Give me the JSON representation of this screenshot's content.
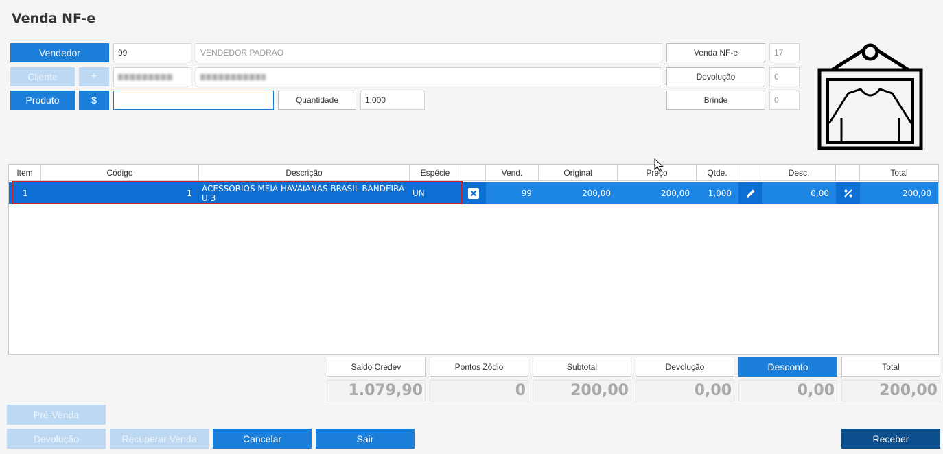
{
  "title": "Venda NF-e",
  "form": {
    "vendedor_label": "Vendedor",
    "vendedor_code": "99",
    "vendedor_name": "VENDEDOR PADRAO",
    "cliente_label": "Cliente",
    "cliente_add": "+",
    "produto_label": "Produto",
    "produto_price": "$",
    "produto_value": "",
    "quantidade_label": "Quantidade",
    "quantidade_value": "1,000"
  },
  "side": {
    "venda_nfe_label": "Venda NF-e",
    "venda_nfe_value": "17",
    "devolucao_label": "Devolução",
    "devolucao_value": "0",
    "brinde_label": "Brinde",
    "brinde_value": "0"
  },
  "grid": {
    "headers": [
      "Item",
      "Código",
      "Descrição",
      "Espécie",
      "",
      "Vend.",
      "Original",
      "Preço",
      "Qtde.",
      "",
      "Desc.",
      "",
      "Total"
    ],
    "rows": [
      {
        "item": "1",
        "codigo": "1",
        "descricao": "ACESSORIOS MEIA HAVAIANAS BRASIL BANDEIRA U 3",
        "especie": "UN",
        "vend": "99",
        "original": "200,00",
        "preco": "200,00",
        "qtde": "1,000",
        "desc": "0,00",
        "total": "200,00"
      }
    ]
  },
  "summary": {
    "headers": [
      "Saldo Credev",
      "Pontos Zôdio",
      "Subtotal",
      "Devolução",
      "Desconto",
      "Total"
    ],
    "values": [
      "1.079,90",
      "0",
      "200,00",
      "0,00",
      "0,00",
      "200,00"
    ]
  },
  "actions": {
    "pre_venda": "Pré-Venda",
    "devolucao": "Devolução",
    "recuperar_venda": "Recuperar Venda",
    "cancelar": "Cancelar",
    "sair": "Sair",
    "receber": "Receber"
  },
  "icons": {
    "remove_item": "close-square-icon",
    "edit_price": "pencil-icon",
    "discount": "percent-icon",
    "product_image": "shirt-frame-icon"
  },
  "colors": {
    "primary": "#1b7fd9",
    "row_selected": "#0d6fd3",
    "receber": "#0d4e8c",
    "disabled": "#bcd8f2"
  }
}
